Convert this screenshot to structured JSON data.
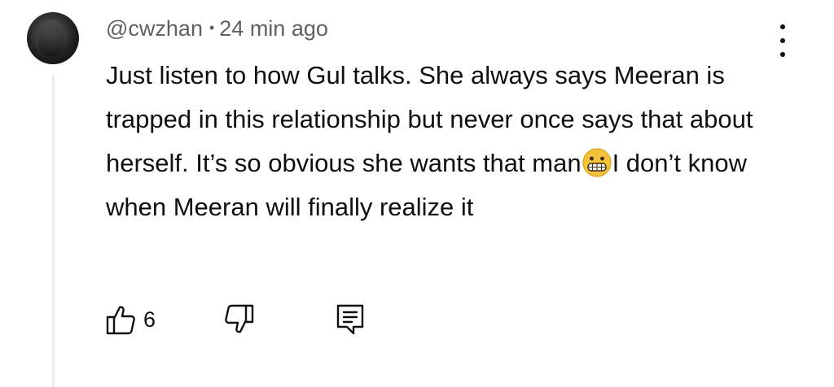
{
  "comment": {
    "author": "@cwzhan",
    "separator": "•",
    "timestamp": "24 min ago",
    "text_before_emoji": "Just listen to how Gul talks. She always says Meeran is trapped in this relationship but never once says that about herself. It’s so obvious she wants that man",
    "emoji": "grimacing-face",
    "text_after_emoji": "I don’t know when Meeran will finally realize it",
    "likes": "6"
  },
  "icons": {
    "menu": "more-vertical-icon",
    "like": "thumbs-up-icon",
    "dislike": "thumbs-down-icon",
    "reply": "comment-reply-icon"
  },
  "colors": {
    "text": "#0f0f0f",
    "meta": "#606060",
    "thread_line": "#ececec",
    "emoji_fill": "#f5c33b"
  }
}
